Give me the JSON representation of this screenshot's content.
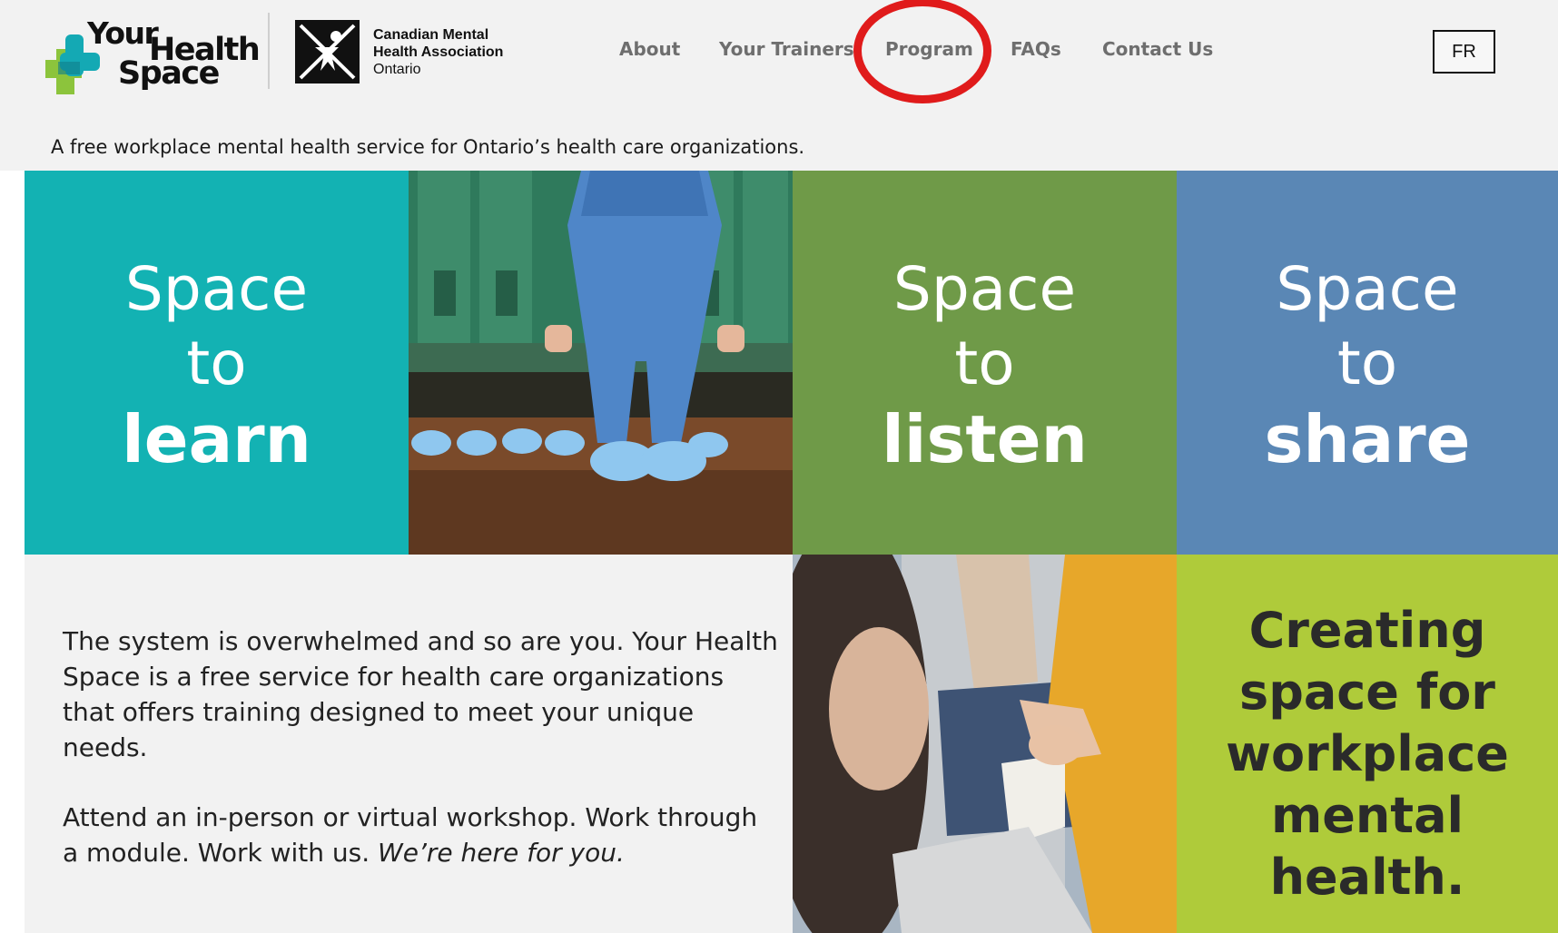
{
  "brand": {
    "yhs_word1": "Your",
    "yhs_word2": "Health",
    "yhs_word3": "Space",
    "cmha_line1": "Canadian Mental",
    "cmha_line2": "Health Association",
    "cmha_line3": "Ontario"
  },
  "nav": {
    "items": [
      {
        "label": "About"
      },
      {
        "label": "Your Trainers"
      },
      {
        "label": "Program"
      },
      {
        "label": "FAQs"
      },
      {
        "label": "Contact Us"
      }
    ],
    "language_button": "FR",
    "highlight_color": "#e01b1b"
  },
  "tagline": "A free workplace mental health service for Ontario’s health care organizations.",
  "tiles": {
    "learn": {
      "line1": "Space",
      "line2": "to",
      "line3": "learn",
      "color": "#13b2b3"
    },
    "listen": {
      "line1": "Space",
      "line2": "to",
      "line3": "listen",
      "color": "#6f9a48"
    },
    "share": {
      "line1": "Space",
      "line2": "to",
      "line3": "share",
      "color": "#5a87b5"
    },
    "creating": {
      "line1": "Creating",
      "line2": "space for",
      "line3": "workplace",
      "line4": "mental",
      "line5": "health.",
      "color": "#afcb3a"
    }
  },
  "body": {
    "paragraph1": "The system is overwhelmed and so are you. Your Health Space is a free service for health care organizations that offers training designed to meet your unique needs.",
    "paragraph2_plain": "Attend an in-person or virtual workshop. Work through a module. Work with us. ",
    "paragraph2_italic": "We’re here for you."
  },
  "colors": {
    "teal": "#13b2b3",
    "green": "#6f9a48",
    "blue": "#5a87b5",
    "lime": "#afcb3a",
    "logo_green": "#8cc43c",
    "logo_teal": "#14a9b4"
  }
}
